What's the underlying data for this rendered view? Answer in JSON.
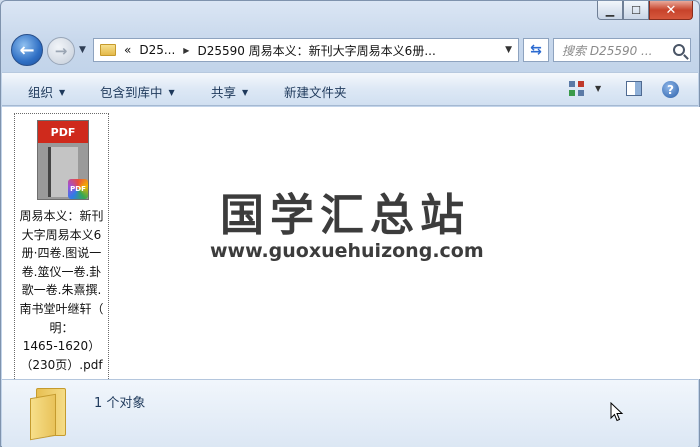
{
  "window": {
    "caption_minimize": "▁",
    "caption_maximize": "☐",
    "caption_close": "✕"
  },
  "nav": {
    "back_glyph": "←",
    "forward_glyph": "→",
    "breadcrumb_overflow": "«",
    "breadcrumb_root": "D25...",
    "breadcrumb_current": "D25590 周易本义：新刊大字周易本义6册...",
    "search_placeholder": "搜索 D25590 ..."
  },
  "toolbar": {
    "organize": "组织",
    "include_in_library": "包含到库中",
    "share": "共享",
    "new_folder": "新建文件夹"
  },
  "file": {
    "thumbnail_label": "PDF",
    "badge_label": "PDF",
    "name_lines": [
      "周易本义：新刊",
      "大字周易本义6",
      "册·四卷.图说一",
      "卷.筮仪一卷.卦",
      "歌一卷.朱熹撰.",
      "南书堂叶继轩（",
      "明：",
      "1465-1620）",
      "（230页）.pdf"
    ]
  },
  "watermark": {
    "title": "国学汇总站",
    "url": "www.guoxuehuizong.com"
  },
  "details": {
    "item_count": "1 个对象"
  }
}
